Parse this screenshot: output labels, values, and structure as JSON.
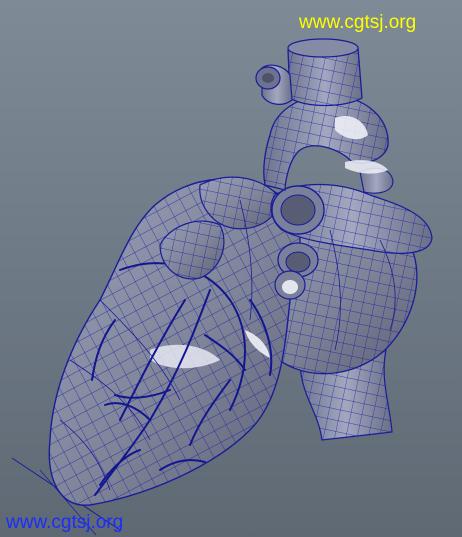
{
  "viewport": {
    "background_top": "#7e8a96",
    "background_bottom": "#5f6974",
    "wireframe_color": "#0c0f9a",
    "surface_color": "#8a8fa8"
  },
  "watermarks": {
    "top_right": {
      "text": "www.cgtsj.org",
      "color": "#ffff00"
    },
    "bottom_left": {
      "text": "www.cgtsj.org",
      "color": "#1b2cff"
    }
  }
}
